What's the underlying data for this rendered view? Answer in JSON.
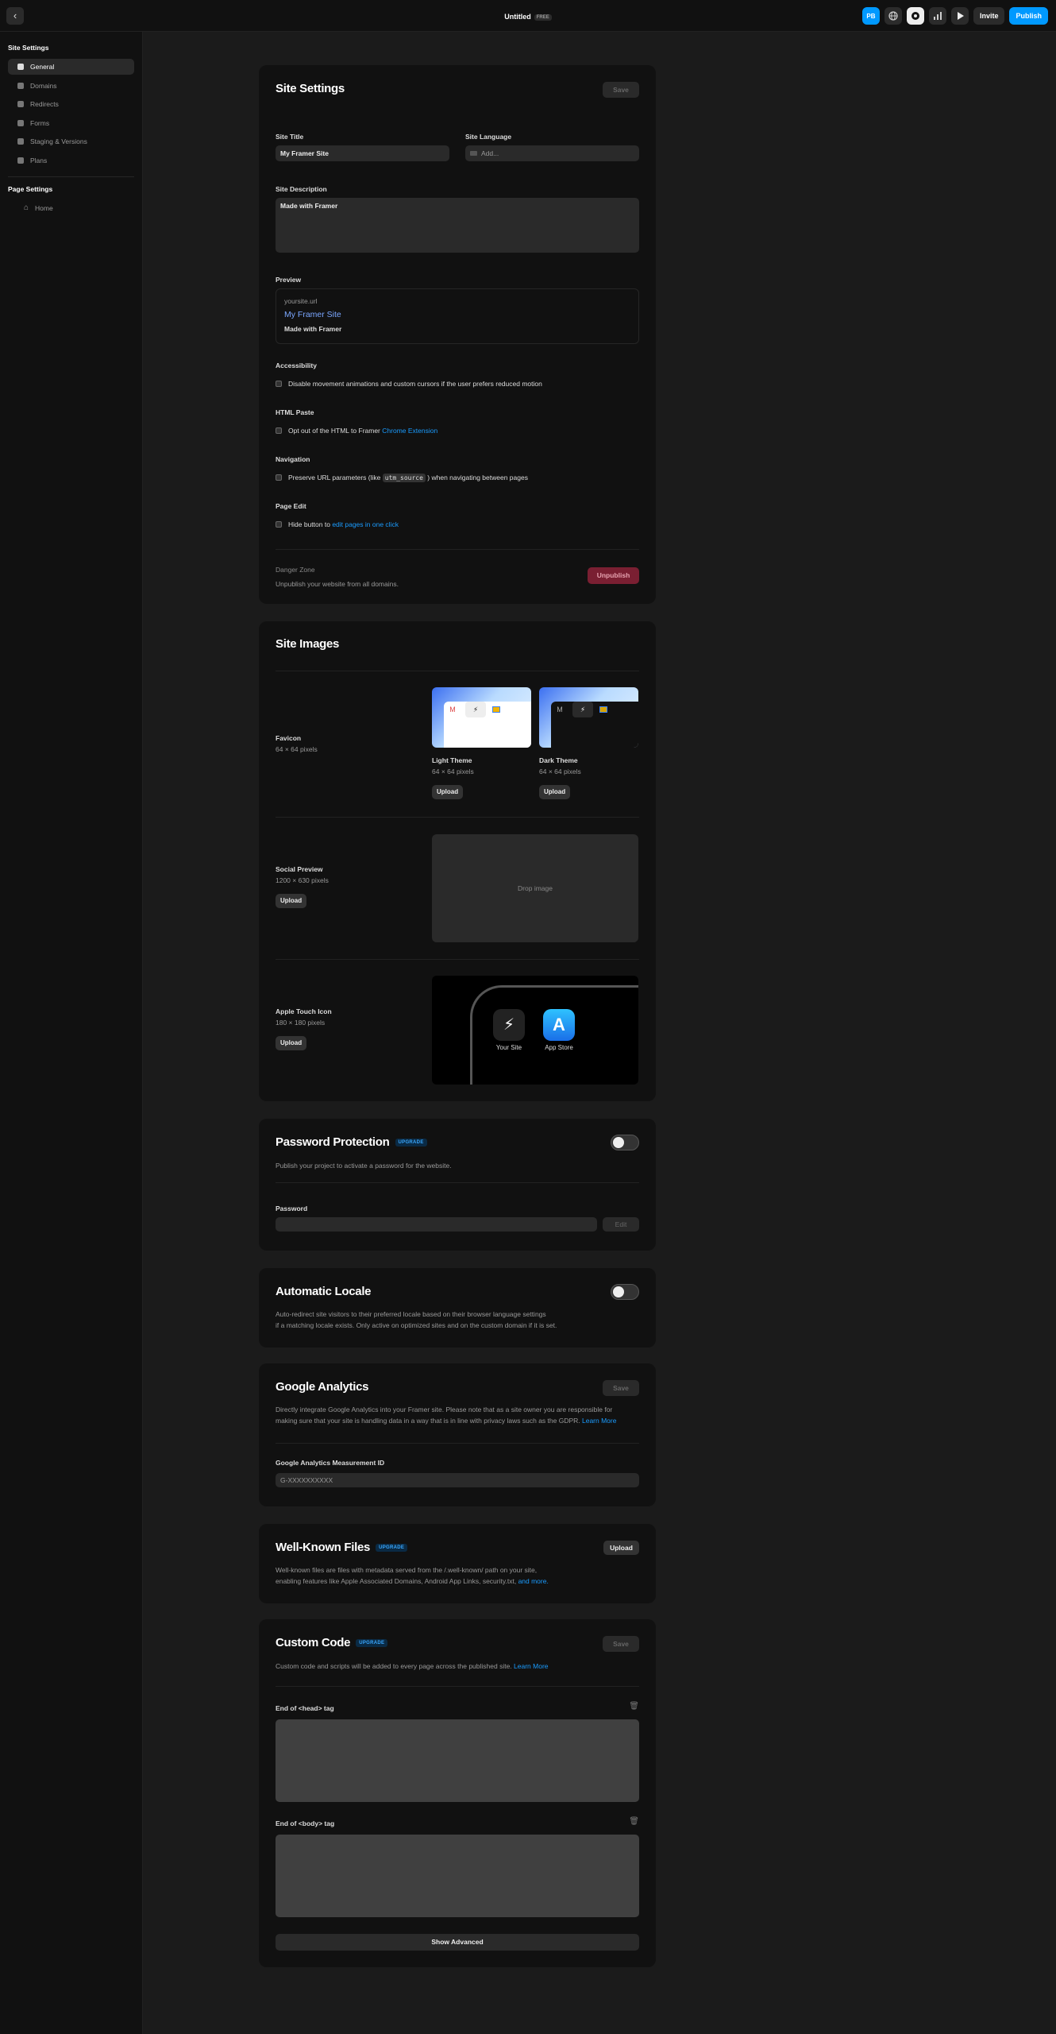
{
  "topbar": {
    "back_icon": "chevron-left-icon",
    "title": "Untitled",
    "plan": "FREE",
    "avatar": "PB",
    "invite": "Invite",
    "publish": "Publish"
  },
  "sidebar": {
    "site_heading": "Site Settings",
    "items": [
      {
        "label": "General",
        "icon": "settings-icon"
      },
      {
        "label": "Domains",
        "icon": "globe-icon"
      },
      {
        "label": "Redirects",
        "icon": "redirect-icon"
      },
      {
        "label": "Forms",
        "icon": "form-icon"
      },
      {
        "label": "Staging & Versions",
        "icon": "clock-icon"
      },
      {
        "label": "Plans",
        "icon": "plan-icon"
      }
    ],
    "page_heading": "Page Settings",
    "page_items": [
      {
        "label": "Home",
        "icon": "home-icon"
      }
    ]
  },
  "site_settings": {
    "title": "Site Settings",
    "save": "Save",
    "site_title_label": "Site Title",
    "site_title_value": "My Framer Site",
    "site_language_label": "Site Language",
    "site_language_placeholder": "Add...",
    "description_label": "Site Description",
    "description_value": "Made with Framer",
    "preview_label": "Preview",
    "preview_url": "yoursite.url",
    "preview_title": "My Framer Site",
    "preview_desc": "Made with Framer",
    "accessibility_label": "Accessibility",
    "accessibility_text": "Disable movement animations and custom cursors if the user prefers reduced motion",
    "html_paste_label": "HTML Paste",
    "html_paste_text": "Opt out of the HTML to Framer",
    "html_paste_link": "Chrome Extension",
    "navigation_label": "Navigation",
    "navigation_text_1": "Preserve URL parameters (like",
    "navigation_code": "utm_source",
    "navigation_text_2": ") when navigating between pages",
    "page_edit_label": "Page Edit",
    "page_edit_text": "Hide button to",
    "page_edit_link": "edit pages in one click",
    "danger_label": "Danger Zone",
    "danger_text": "Unpublish your website from all domains.",
    "unpublish": "Unpublish"
  },
  "site_images": {
    "title": "Site Images",
    "favicon_label": "Favicon",
    "favicon_size": "64 × 64 pixels",
    "light_label": "Light Theme",
    "light_size": "64 × 64 pixels",
    "dark_label": "Dark Theme",
    "dark_size": "64 × 64 pixels",
    "upload": "Upload",
    "social_label": "Social Preview",
    "social_size": "1200 × 630 pixels",
    "drop": "Drop image",
    "apple_label": "Apple Touch Icon",
    "apple_size": "180 × 180 pixels",
    "your_site": "Your Site",
    "app_store": "App Store"
  },
  "password": {
    "title": "Password Protection",
    "badge": "UPGRADE",
    "text": "Publish your project to activate a password for the website.",
    "label": "Password",
    "edit": "Edit"
  },
  "locale": {
    "title": "Automatic Locale",
    "text_1": "Auto-redirect site visitors to their preferred locale based on their browser language settings",
    "text_2": "if a matching locale exists. Only active on optimized sites and on the custom domain if it is set."
  },
  "analytics": {
    "title": "Google Analytics",
    "save": "Save",
    "text_1": "Directly integrate Google Analytics into your Framer site. Please note that as a site owner you are responsible for",
    "text_2": "making sure that your site is handling data in a way that is in line with privacy laws such as the GDPR.",
    "learn_more": "Learn More",
    "id_label": "Google Analytics Measurement ID",
    "id_placeholder": "G-XXXXXXXXXX"
  },
  "wellknown": {
    "title": "Well-Known Files",
    "badge": "UPGRADE",
    "upload": "Upload",
    "text_1": "Well-known files are files with metadata served from the /.well-known/ path on your site,",
    "text_2": "enabling features like Apple Associated Domains, Android App Links, security.txt,",
    "and_more": "and more."
  },
  "custom_code": {
    "title": "Custom Code",
    "badge": "UPGRADE",
    "save": "Save",
    "text": "Custom code and scripts will be added to every page across the published site.",
    "learn_more": "Learn More",
    "head_label": "End of <head> tag",
    "body_label": "End of <body> tag",
    "advanced": "Show Advanced"
  }
}
